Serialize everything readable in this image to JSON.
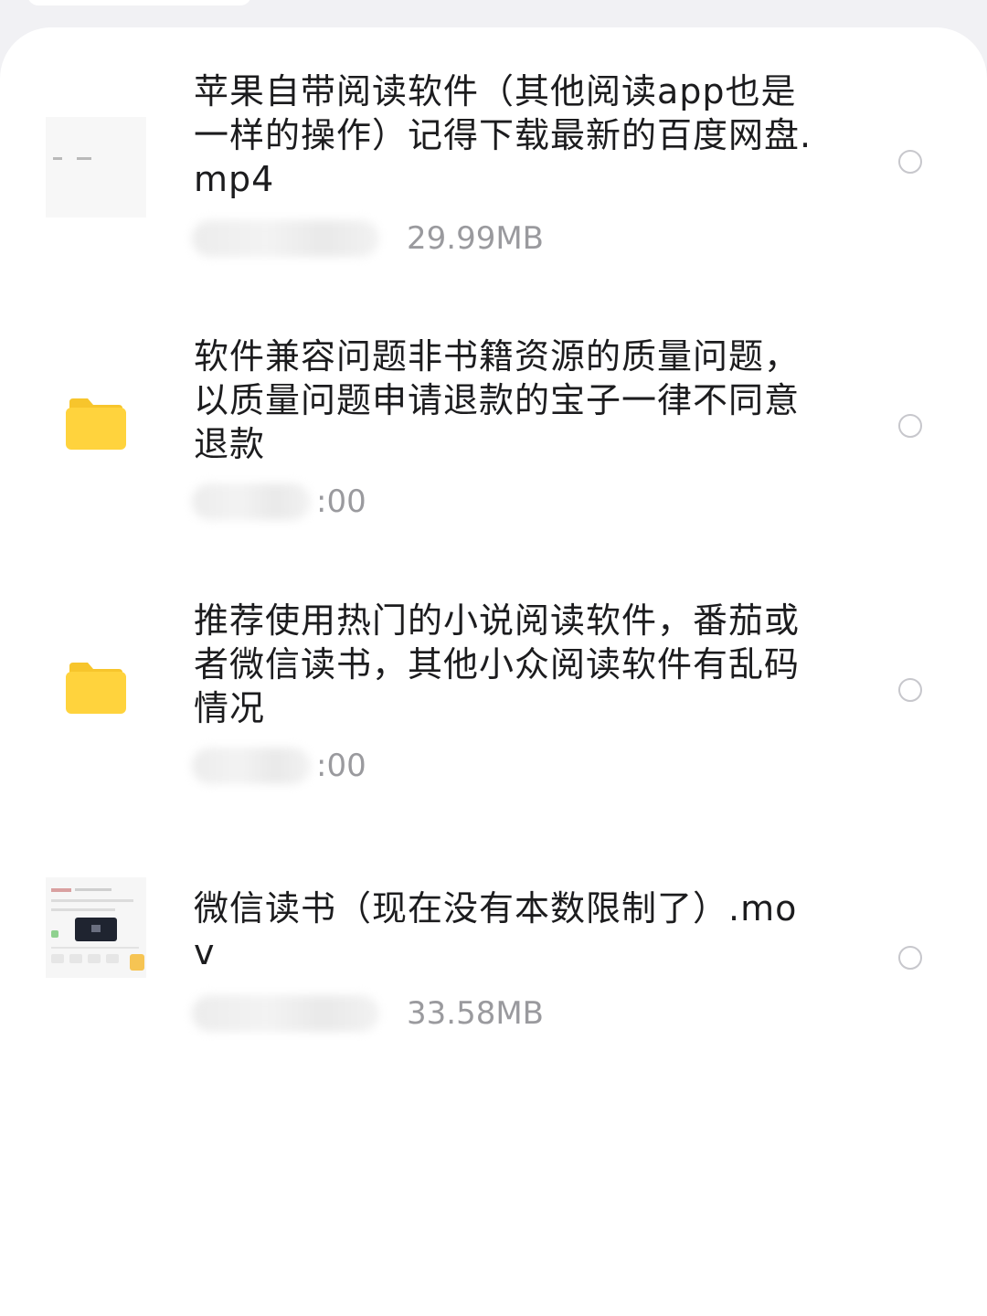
{
  "files": [
    {
      "name": "苹果自带阅读软件（其他阅读app也是一样的操作）记得下载最新的百度网盘.mp4",
      "meta_tail": "29.99MB",
      "icon": "video-thumbnail-icon"
    },
    {
      "name": "软件兼容问题非书籍资源的质量问题，以质量问题申请退款的宝子一律不同意退款",
      "meta_tail": ":00",
      "icon": "folder-icon"
    },
    {
      "name": "推荐使用热门的小说阅读软件，番茄或者微信读书，其他小众阅读软件有乱码情况",
      "meta_tail": ":00",
      "icon": "folder-icon"
    },
    {
      "name": "微信读书（现在没有本数限制了）.mov",
      "meta_tail": "33.58MB",
      "icon": "video-thumbnail-icon"
    }
  ],
  "colors": {
    "folder": "#ffd33d",
    "radio_border": "#c7c7cc",
    "meta_text": "#9a9a9e"
  }
}
